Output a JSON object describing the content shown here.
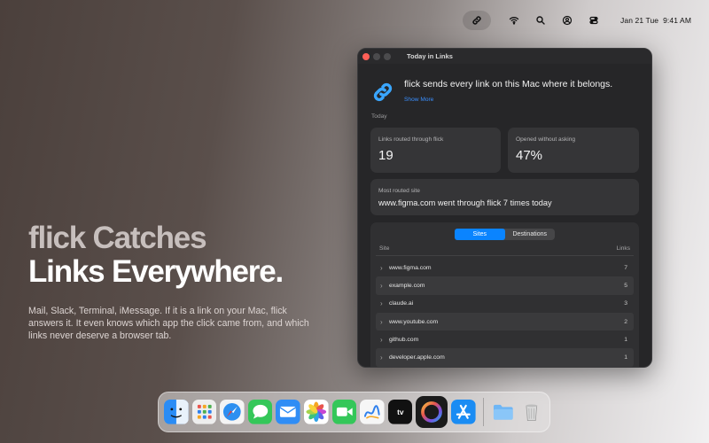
{
  "menubar": {
    "date": "Jan 21 Tue",
    "time": "9:41 AM",
    "icons": [
      "flick-link-icon",
      "wifi-icon",
      "search-icon",
      "user-icon",
      "control-center-icon"
    ]
  },
  "hero": {
    "line1": "flick Catches",
    "line2": "Links Everywhere.",
    "body": "Mail, Slack, Terminal, iMessage. If it is a link on your Mac, flick answers it. It even knows which app the click came from, and which links never deserve a browser tab."
  },
  "window": {
    "title": "Today in Links",
    "tagline": "flick sends every link on this Mac where it belongs.",
    "show_more": "Show More",
    "section": "Today",
    "stats": [
      {
        "label": "Links routed through flick",
        "value": "19"
      },
      {
        "label": "Opened without asking",
        "value": "47%"
      }
    ],
    "most_routed": {
      "label": "Most routed site",
      "text": "www.figma.com went through flick 7 times today"
    },
    "tabs": [
      {
        "label": "Sites",
        "active": true
      },
      {
        "label": "Destinations",
        "active": false
      }
    ],
    "columns": {
      "site": "Site",
      "links": "Links"
    },
    "rows": [
      {
        "site": "www.figma.com",
        "links": "7"
      },
      {
        "site": "example.com",
        "links": "5"
      },
      {
        "site": "claude.ai",
        "links": "3"
      },
      {
        "site": "www.youtube.com",
        "links": "2"
      },
      {
        "site": "github.com",
        "links": "1"
      },
      {
        "site": "developer.apple.com",
        "links": "1"
      }
    ]
  },
  "dock": {
    "apps": [
      "finder-icon",
      "launchpad-icon",
      "safari-icon",
      "messages-icon",
      "mail-icon",
      "photos-icon",
      "facetime-icon",
      "freeform-icon",
      "apple-tv-icon",
      "flick-app-icon",
      "app-store-icon",
      "folder-icon",
      "trash-icon"
    ]
  },
  "colors": {
    "accent": "#0a84ff",
    "flick_blue": "#3aa6ff",
    "window_bg": "#262628",
    "card_bg": "#353537"
  }
}
